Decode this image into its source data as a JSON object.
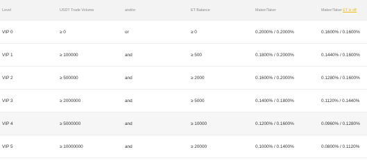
{
  "header": {
    "level": "Level",
    "volume": "USDT Trade Volume",
    "andor": "and/or",
    "balance": "ET Balance",
    "maker_taker": "Maker/Taker",
    "maker_taker_et": "Maker/Taker",
    "et_off_link": "ET is off"
  },
  "rows": [
    {
      "level": "VIP 0",
      "volume": "≥ 0",
      "andor": "or",
      "balance": "≥ 0",
      "maker_taker": "0.2000% / 0.2000%",
      "maker_taker_et": "0.1600% / 0.1600%"
    },
    {
      "level": "VIP 1",
      "volume": "≥ 100000",
      "andor": "and",
      "balance": "≥ 500",
      "maker_taker": "0.1800% / 0.2000%",
      "maker_taker_et": "0.1440% / 0.1600%"
    },
    {
      "level": "VIP 2",
      "volume": "≥ 500000",
      "andor": "and",
      "balance": "≥ 2000",
      "maker_taker": "0.1600% / 0.2000%",
      "maker_taker_et": "0.1280% / 0.1600%"
    },
    {
      "level": "VIP 3",
      "volume": "≥ 2000000",
      "andor": "and",
      "balance": "≥ 5000",
      "maker_taker": "0.1400% / 0.1800%",
      "maker_taker_et": "0.1120% / 0.1440%"
    },
    {
      "level": "VIP 4",
      "volume": "≥ 5000000",
      "andor": "and",
      "balance": "≥ 10000",
      "maker_taker": "0.1200% / 0.1600%",
      "maker_taker_et": "0.0960% / 0.1280%"
    },
    {
      "level": "VIP 5",
      "volume": "≥ 10000000",
      "andor": "and",
      "balance": "≥ 20000",
      "maker_taker": "0.1000% / 0.1400%",
      "maker_taker_et": "0.0800% / 0.1120%"
    }
  ],
  "colors": {
    "link": "#f0b90b",
    "header_bg": "#f3f3f3",
    "shaded_row_bg": "#f6f6f6"
  }
}
